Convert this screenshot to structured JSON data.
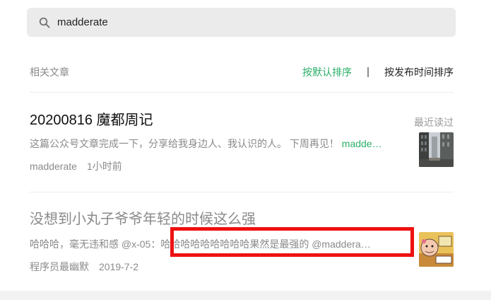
{
  "search": {
    "value": "madderate"
  },
  "header": {
    "section_label": "相关文章",
    "sort_default": "按默认排序",
    "sort_time": "按发布时间排序"
  },
  "articles": [
    {
      "title": "20200816 魔都周记",
      "tag": "最近读过",
      "snippet_text": "这篇公众号文章完成一下，分享给我身边人、我认识的人。 下周再见！",
      "snippet_highlight": "madde…",
      "source": "madderate",
      "time": "1小时前",
      "thumb_icon": "city-street-photo"
    },
    {
      "title": "没想到小丸子爷爷年轻的时候这么强",
      "snippet_text": "哈哈哈，毫无违和感 @x-05：哈哈哈哈哈哈哈哈哈果然是最强的 @maddera…",
      "source": "程序员最幽默",
      "time": "2019-7-2",
      "thumb_icon": "cartoon-grandpa-image"
    }
  ],
  "colors": {
    "accent_green": "#2aae67",
    "highlight_red": "#ee1111"
  }
}
